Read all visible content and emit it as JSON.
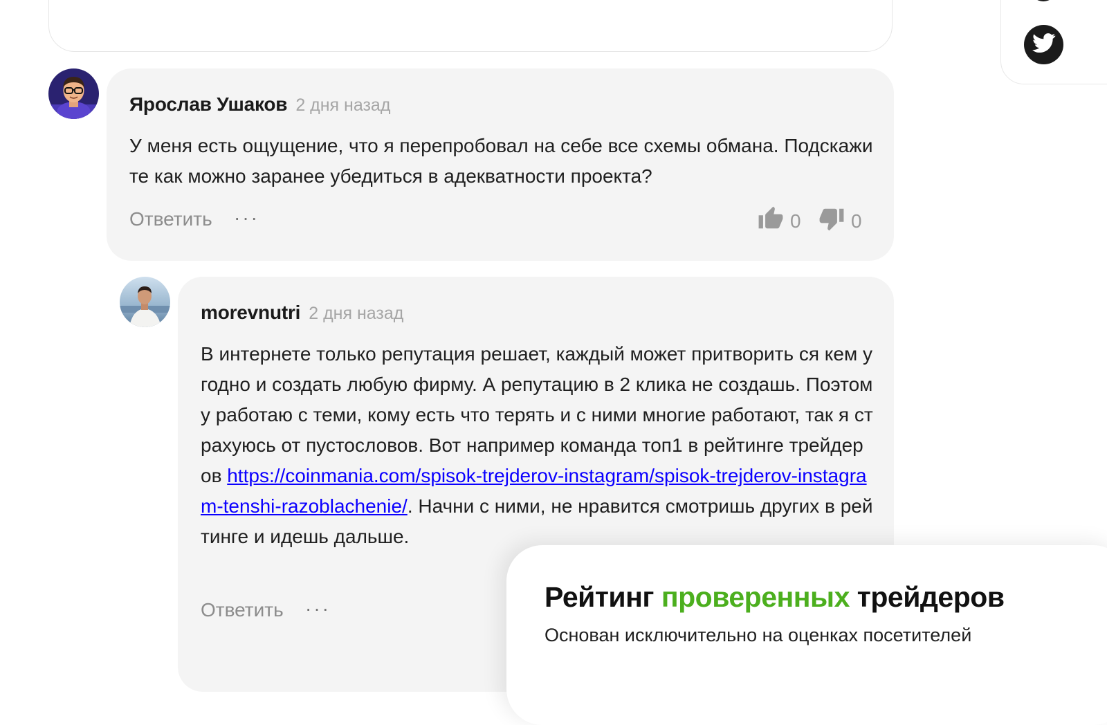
{
  "colors": {
    "comment_bg": "#f4f4f4",
    "link": "#0b00ff",
    "accent_green": "#4caf1e",
    "muted_text": "#a6a6a6"
  },
  "share": {
    "twitter_icon": "twitter-icon"
  },
  "comments": [
    {
      "author": "Ярослав Ушаков",
      "date": "2 дня назад",
      "text": "У меня есть ощущение, что я перепробовал на себе все схемы обмана. Подскажите как можно заранее убедиться в адекватности проекта?",
      "reply_label": "Ответить",
      "more_label": "···",
      "likes": "0",
      "dislikes": "0"
    },
    {
      "author": "morevnutri",
      "date": "2 дня назад",
      "text_before_link": "В интернете только репутация решает, каждый может притворить ся кем угодно и создать любую фирму. А репутацию в 2 клика не создашь. Поэтому работаю с теми, кому есть что терять и с ними многие работают, так я страхуюсь от пустословов. Вот например команда топ1 в рейтинге трейдеров ",
      "link_text": "https://coinmania.com/spisok-trejderov-instagram/spisok-trejderov-instagram-tenshi-razoblachenie/",
      "text_after_link": ". Начни с ними, не нравится смотришь других в рейтинге и идешь дальше.",
      "reply_label": "Ответить",
      "more_label": "···"
    }
  ],
  "rating_popup": {
    "title_part1": "Рейтинг ",
    "title_accent": "проверенных",
    "title_part2": " трейдеров",
    "subtitle": "Основан исключительно на оценках посетителей"
  }
}
